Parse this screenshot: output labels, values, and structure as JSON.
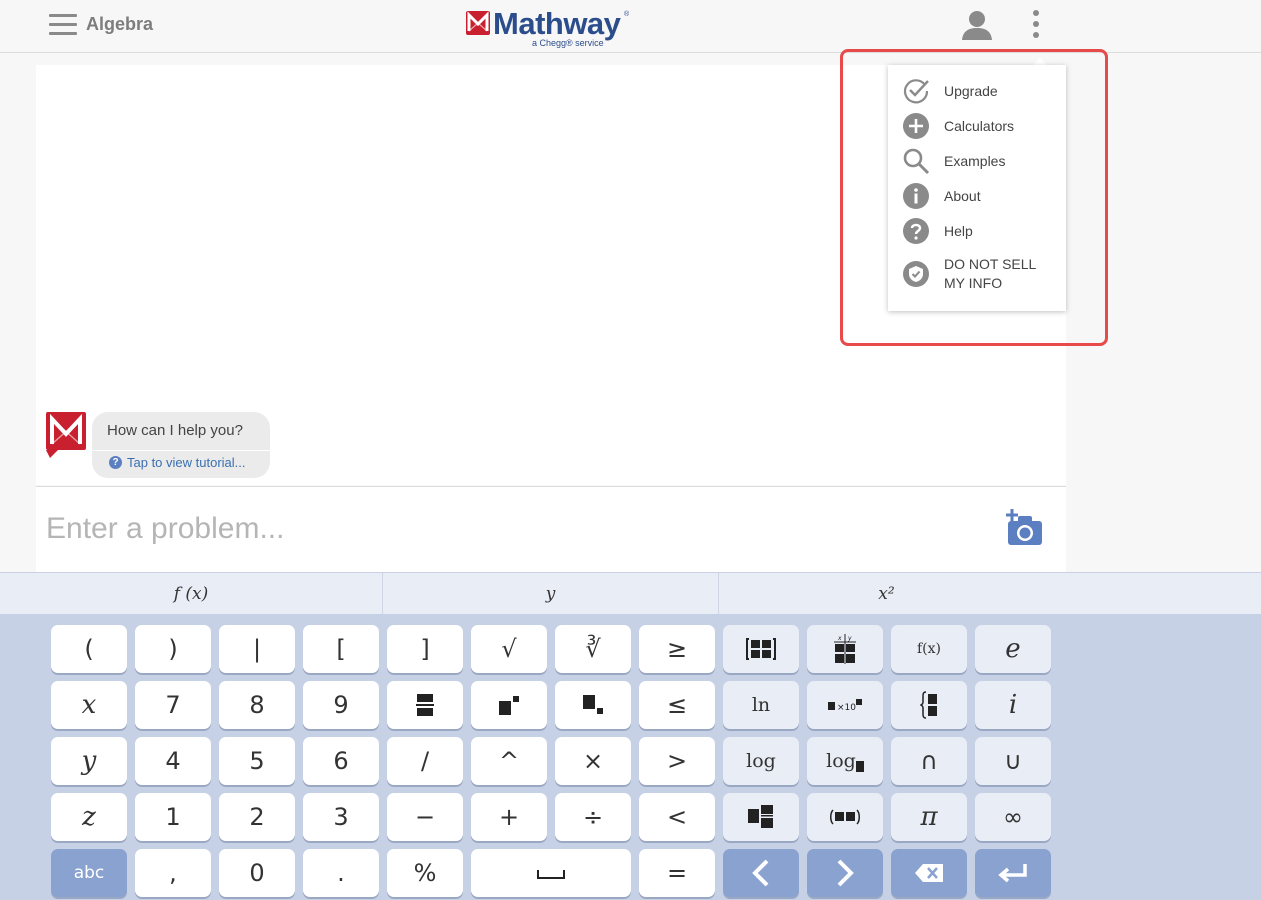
{
  "header": {
    "subject": "Algebra",
    "logo_text": "Mathway",
    "logo_tm": "®",
    "logo_sub": "a Chegg® service"
  },
  "menu": {
    "items": [
      {
        "label": "Upgrade",
        "icon": "check-circle-icon"
      },
      {
        "label": "Calculators",
        "icon": "plus-circle-icon"
      },
      {
        "label": "Examples",
        "icon": "search-icon"
      },
      {
        "label": "About",
        "icon": "info-icon"
      },
      {
        "label": "Help",
        "icon": "help-icon"
      },
      {
        "label_line1": "DO NOT SELL",
        "label_line2": "MY INFO",
        "icon": "shield-check-icon"
      }
    ]
  },
  "chat": {
    "question": "How can I help you?",
    "tutorial_link": "Tap to view tutorial..."
  },
  "input": {
    "placeholder": "Enter a problem..."
  },
  "keyboard": {
    "tabs": [
      "f (x)",
      "y",
      "x²"
    ],
    "rows": [
      [
        "(",
        ")",
        "|",
        "[",
        "]",
        "√",
        "∛",
        "≥",
        "matrix",
        "table",
        "f(x)",
        "e"
      ],
      [
        "x",
        "7",
        "8",
        "9",
        "fraction",
        "superscript",
        "subscript",
        "≤",
        "ln",
        "sci-notation",
        "piecewise",
        "i"
      ],
      [
        "y",
        "4",
        "5",
        "6",
        "/",
        "^",
        "×",
        ">",
        "log",
        "log base",
        "∩",
        "∪"
      ],
      [
        "z",
        "1",
        "2",
        "3",
        "−",
        "+",
        "÷",
        "<",
        "mixed-number",
        "point",
        "π",
        "∞"
      ],
      [
        "abc",
        ",",
        "0",
        ".",
        "%",
        "space",
        "=",
        "left",
        "right",
        "backspace",
        "enter"
      ]
    ],
    "labels": {
      "open_paren": "(",
      "close_paren": ")",
      "pipe": "|",
      "open_bracket": "[",
      "close_bracket": "]",
      "sqrt": "√",
      "cbrt": "∛",
      "geq": "≥",
      "fx": "f(x)",
      "e": "e",
      "x": "x",
      "seven": "7",
      "eight": "8",
      "nine": "9",
      "leq": "≤",
      "ln": "ln",
      "i": "i",
      "y": "y",
      "four": "4",
      "five": "5",
      "six": "6",
      "slash": "/",
      "caret": "^",
      "times": "×",
      "gt": ">",
      "log": "log",
      "log_base": "log",
      "cap": "∩",
      "cup": "∪",
      "z": "z",
      "one": "1",
      "two": "2",
      "three": "3",
      "minus": "−",
      "plus": "+",
      "divide": "÷",
      "lt": "<",
      "pi": "π",
      "infinity": "∞",
      "abc": "abc",
      "comma": ",",
      "zero": "0",
      "dot": ".",
      "percent": "%",
      "equals": "=",
      "sci_text": "×10"
    }
  },
  "colors": {
    "brand_blue": "#2b4d8c",
    "brand_red": "#c8202f",
    "keyboard_bg": "#c6d1e5",
    "highlight": "#e84a4a",
    "accent_key": "#8aa2d0"
  }
}
